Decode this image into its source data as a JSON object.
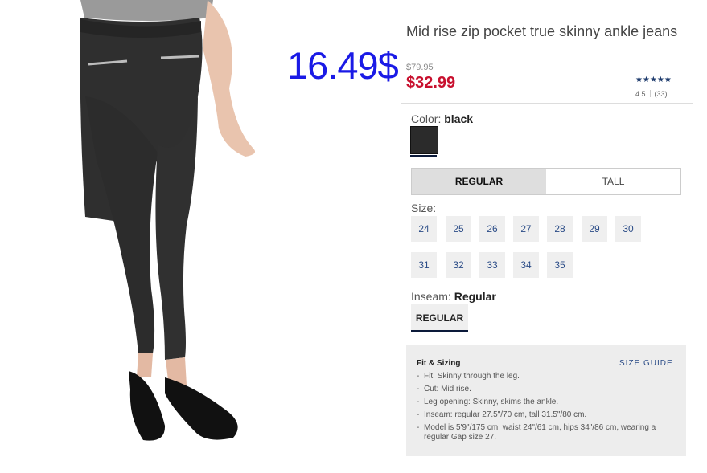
{
  "product": {
    "title": "Mid rise zip pocket true skinny ankle jeans",
    "original_price": "$79.95",
    "sale_price": "$32.99",
    "overlay_price": "16.49$",
    "rating_value": "4.5",
    "review_count": "(33)",
    "stars": "★★★★★"
  },
  "color": {
    "label": "Color:",
    "value": "black"
  },
  "fit_options": [
    {
      "label": "REGULAR",
      "selected": true
    },
    {
      "label": "TALL",
      "selected": false
    }
  ],
  "size": {
    "label": "Size:",
    "options": [
      "24",
      "25",
      "26",
      "27",
      "28",
      "29",
      "30",
      "31",
      "32",
      "33",
      "34",
      "35"
    ]
  },
  "inseam": {
    "label": "Inseam:",
    "value": "Regular",
    "option": "REGULAR"
  },
  "fit_sizing": {
    "title": "Fit & Sizing",
    "guide_link": "SIZE GUIDE",
    "items": [
      "Fit: Skinny through the leg.",
      "Cut: Mid rise.",
      "Leg opening: Skinny, skims the ankle.",
      "Inseam: regular 27.5\"/70 cm, tall 31.5\"/80 cm.",
      "Model is 5'9\"/175 cm, waist 24\"/61 cm, hips 34\"/86 cm, wearing a regular Gap size 27."
    ]
  },
  "colors": {
    "sale": "#c8102e",
    "overlay": "#1a1ae6",
    "link": "#2b4c87",
    "navy_underline": "#0c1a3a"
  }
}
